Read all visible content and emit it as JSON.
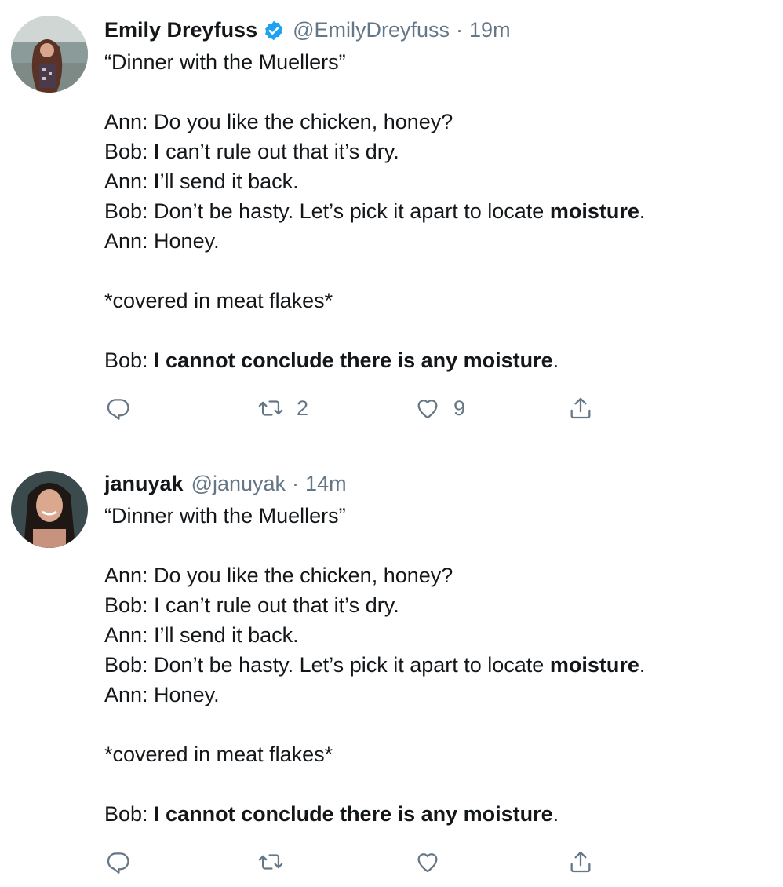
{
  "tweets": [
    {
      "author_name": "Emily Dreyfuss",
      "verified": true,
      "handle": "@EmilyDreyfuss",
      "separator": "·",
      "time": "19m",
      "title_line": "“Dinner with the Muellers”",
      "lines": [
        {
          "a": "Ann: Do you like the chicken, honey?"
        },
        {
          "a": "Bob: ",
          "b": "I",
          "c": " can’t rule out that it’s dry."
        },
        {
          "a": "Ann: ",
          "b": "I",
          "c": "’ll send it back."
        },
        {
          "a": "Bob: Don’t be hasty. Let’s pick it apart to locate ",
          "b": "moisture",
          "c": "."
        },
        {
          "a": "Ann: Honey."
        }
      ],
      "aside": "*covered in meat flakes*",
      "closing": {
        "a": "Bob: ",
        "b": "I cannot conclude there is any moisture",
        "c": "."
      },
      "retweets": "2",
      "likes": "9"
    },
    {
      "author_name": "januyak",
      "verified": false,
      "handle": "@januyak",
      "separator": "·",
      "time": "14m",
      "title_line": "“Dinner with the Muellers”",
      "lines": [
        {
          "a": "Ann: Do you like the chicken, honey?"
        },
        {
          "a": "Bob: I can’t rule out that it’s dry."
        },
        {
          "a": "Ann: I’ll send it back."
        },
        {
          "a": "Bob: Don’t be hasty. Let’s pick it apart to locate ",
          "b": "moisture",
          "c": "."
        },
        {
          "a": "Ann: Honey."
        }
      ],
      "aside": "*covered in meat flakes*",
      "closing": {
        "a": "Bob: ",
        "b": "I cannot conclude there is any moisture",
        "c": "."
      },
      "retweets": "",
      "likes": ""
    }
  ],
  "icons": {
    "reply": "reply-icon",
    "retweet": "retweet-icon",
    "like": "heart-icon",
    "share": "share-icon",
    "verified": "verified-badge-icon"
  },
  "colors": {
    "text": "#14171a",
    "secondary": "#657786",
    "verified": "#1da1f2",
    "divider": "#e6ecf0"
  }
}
